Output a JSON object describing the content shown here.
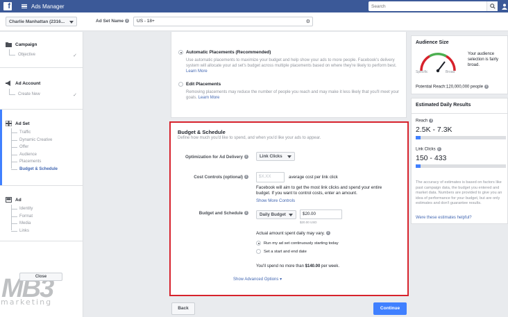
{
  "topbar": {
    "logo": "f",
    "app_title": "Ads Manager",
    "search_placeholder": "Search"
  },
  "subbar": {
    "account": "Charlie Manhattan (2316...",
    "adset_name_label": "Ad Set Name",
    "adset_name_value": "US - 18+"
  },
  "sidebar": {
    "campaign": {
      "title": "Campaign",
      "sub": "Objective"
    },
    "ad_account": {
      "title": "Ad Account",
      "sub": "Create New"
    },
    "ad_set": {
      "title": "Ad Set",
      "items": [
        "Traffic",
        "Dynamic Creative",
        "Offer",
        "Audience",
        "Placements",
        "Budget & Schedule"
      ]
    },
    "ad": {
      "title": "Ad",
      "items": [
        "Identity",
        "Format",
        "Media",
        "Links"
      ]
    },
    "close_label": "Close",
    "watermark_big": "MB3",
    "watermark_small": "marketing"
  },
  "placements": {
    "auto_title": "Automatic Placements (Recommended)",
    "auto_desc": "Use automatic placements to maximize your budget and help show your ads to more people. Facebook's delivery system will allocate your ad set's budget across multiple placements based on where they're likely to perform best.",
    "auto_learn": "Learn More",
    "edit_title": "Edit Placements",
    "edit_desc": "Removing placements may reduce the number of people you reach and may make it less likely that you'll meet your goals.",
    "edit_learn": "Learn More"
  },
  "budget": {
    "title": "Budget & Schedule",
    "subtitle": "Define how much you'd like to spend, and when you'd like your ads to appear.",
    "optimization_label": "Optimization for Ad Delivery",
    "optimization_value": "Link Clicks",
    "cost_label": "Cost Controls (optional)",
    "cost_placeholder": "$X.XX",
    "cost_suffix": "average cost per link click",
    "cost_help": "Facebook will aim to get the most link clicks and spend your entire budget. If you want to control costs, enter an amount.",
    "show_more": "Show More Controls",
    "budget_label": "Budget and Schedule",
    "budget_type": "Daily Budget",
    "budget_value": "$20.00",
    "budget_currency": "$20.00 USD",
    "actual_spent": "Actual amount spent daily may vary.",
    "schedule_opt1": "Run my ad set continuously starting today",
    "schedule_opt2": "Set a start and end date",
    "spend_prefix": "You'll spend no more than ",
    "spend_amount": "$140.00",
    "spend_suffix": " per week.",
    "advanced": "Show Advanced Options"
  },
  "buttons": {
    "back": "Back",
    "continue": "Continue"
  },
  "audience": {
    "title": "Audience Size",
    "specific": "Specific",
    "broad": "Broad",
    "note": "Your audience selection is fairly broad.",
    "reach": "Potential Reach:120,000,000 people"
  },
  "estimates": {
    "title": "Estimated Daily Results",
    "reach_label": "Reach",
    "reach_value": "2.5K - 7.3K",
    "reach_fill": 0.05,
    "clicks_label": "Link Clicks",
    "clicks_value": "150 - 433",
    "clicks_fill": 0.05,
    "note": "The accuracy of estimates is based on factors like past campaign data, the budget you entered and market data. Numbers are provided to give you an idea of performance for your budget, but are only estimates and don't guarantee results.",
    "link": "Were these estimates helpful?"
  },
  "colors": {
    "brand": "#3b5998",
    "accent": "#4080ff",
    "highlight": "#d7222c"
  }
}
